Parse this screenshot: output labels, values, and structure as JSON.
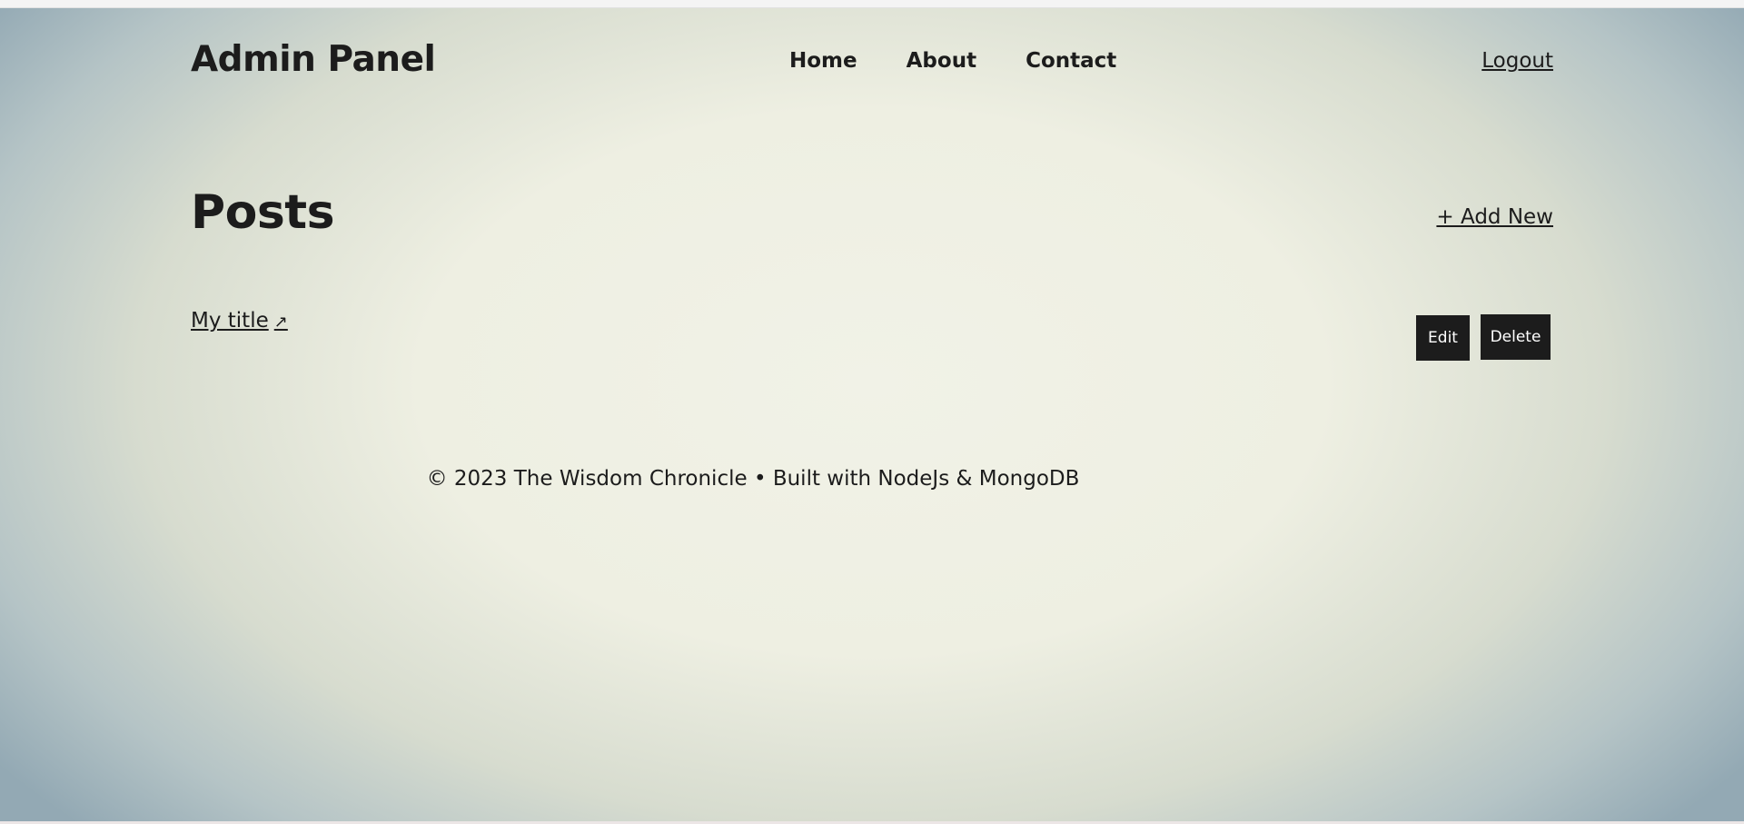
{
  "header": {
    "brand": "Admin Panel",
    "nav": [
      "Home",
      "About",
      "Contact"
    ],
    "logout": "Logout"
  },
  "posts": {
    "title": "Posts",
    "add_new": "+ Add New",
    "items": [
      {
        "title": "My title",
        "arrow": "↗",
        "edit_label": "Edit",
        "delete_label": "Delete"
      }
    ]
  },
  "footer": {
    "text": "© 2023 The Wisdom Chronicle • Built with NodeJs & MongoDB"
  },
  "colors": {
    "text": "#1c1c1c",
    "button_bg": "#1c1c1c",
    "button_text": "#ffffff",
    "bg_center": "#f1f2e7",
    "bg_edge": "#93a9b4"
  }
}
